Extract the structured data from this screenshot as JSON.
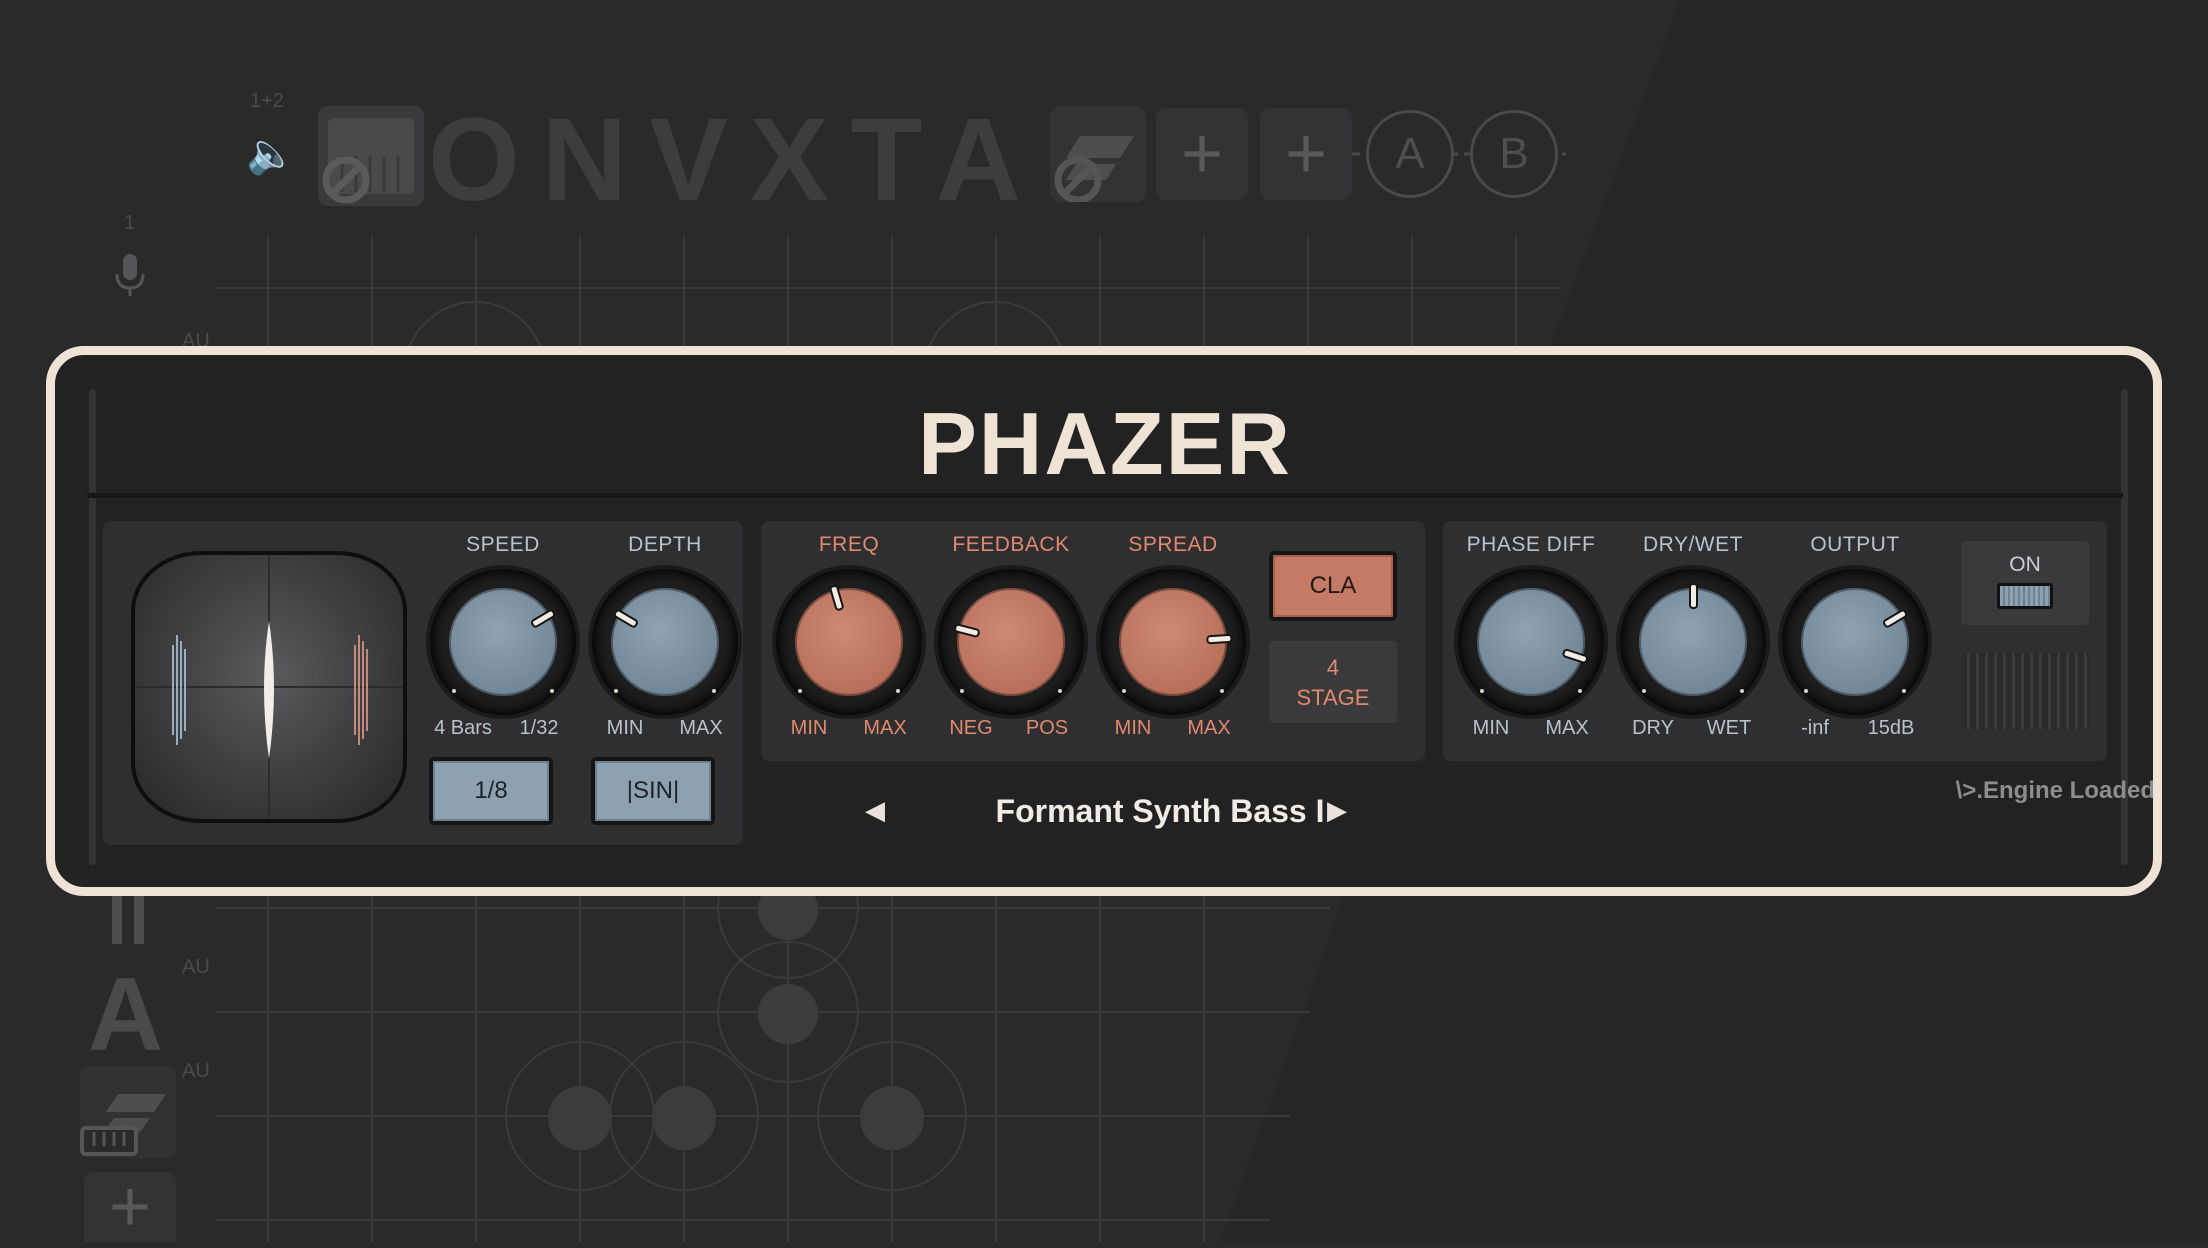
{
  "host": {
    "channel_labels": [
      "1+2",
      "1"
    ],
    "au_labels": [
      "AU",
      "AU",
      "AU",
      "AU"
    ],
    "logo_text": "ONVXTA",
    "slot_a": "A",
    "slot_b": "B"
  },
  "plugin": {
    "title": "PHAZER",
    "lfo": {
      "speed": {
        "label": "SPEED",
        "min": "4 Bars",
        "max": "1/32",
        "value": 0.72
      },
      "depth": {
        "label": "DEPTH",
        "min": "MIN",
        "max": "MAX",
        "value": 0.28
      },
      "rate_button": "1/8",
      "shape_button": "|SIN|"
    },
    "phaser": {
      "freq": {
        "label": "FREQ",
        "min": "MIN",
        "max": "MAX",
        "value": 0.44
      },
      "feedback": {
        "label": "FEEDBACK",
        "min": "NEG",
        "max": "POS",
        "value": 0.22
      },
      "spread": {
        "label": "SPREAD",
        "min": "MIN",
        "max": "MAX",
        "value": 0.82
      },
      "mode_button": "CLA",
      "stages": "4",
      "stages_label": "STAGE"
    },
    "mix": {
      "phase_diff": {
        "label": "PHASE DIFF",
        "min": "MIN",
        "max": "MAX",
        "value": 0.9
      },
      "dry_wet": {
        "label": "DRY/WET",
        "min": "DRY",
        "max": "WET",
        "value": 0.5
      },
      "output": {
        "label": "OUTPUT",
        "min": "-inf",
        "max": "15dB",
        "value": 0.72
      }
    },
    "power": {
      "label": "ON"
    },
    "preset": {
      "prev": "◀",
      "name": "Formant Synth Bass I",
      "next": "▶"
    },
    "status": "\\>.Engine Loaded"
  },
  "colors": {
    "frame": "#efe3d6",
    "blue_knob": "#7d92a2",
    "orange_knob": "#c07a64",
    "orange_text": "#e0896f"
  }
}
